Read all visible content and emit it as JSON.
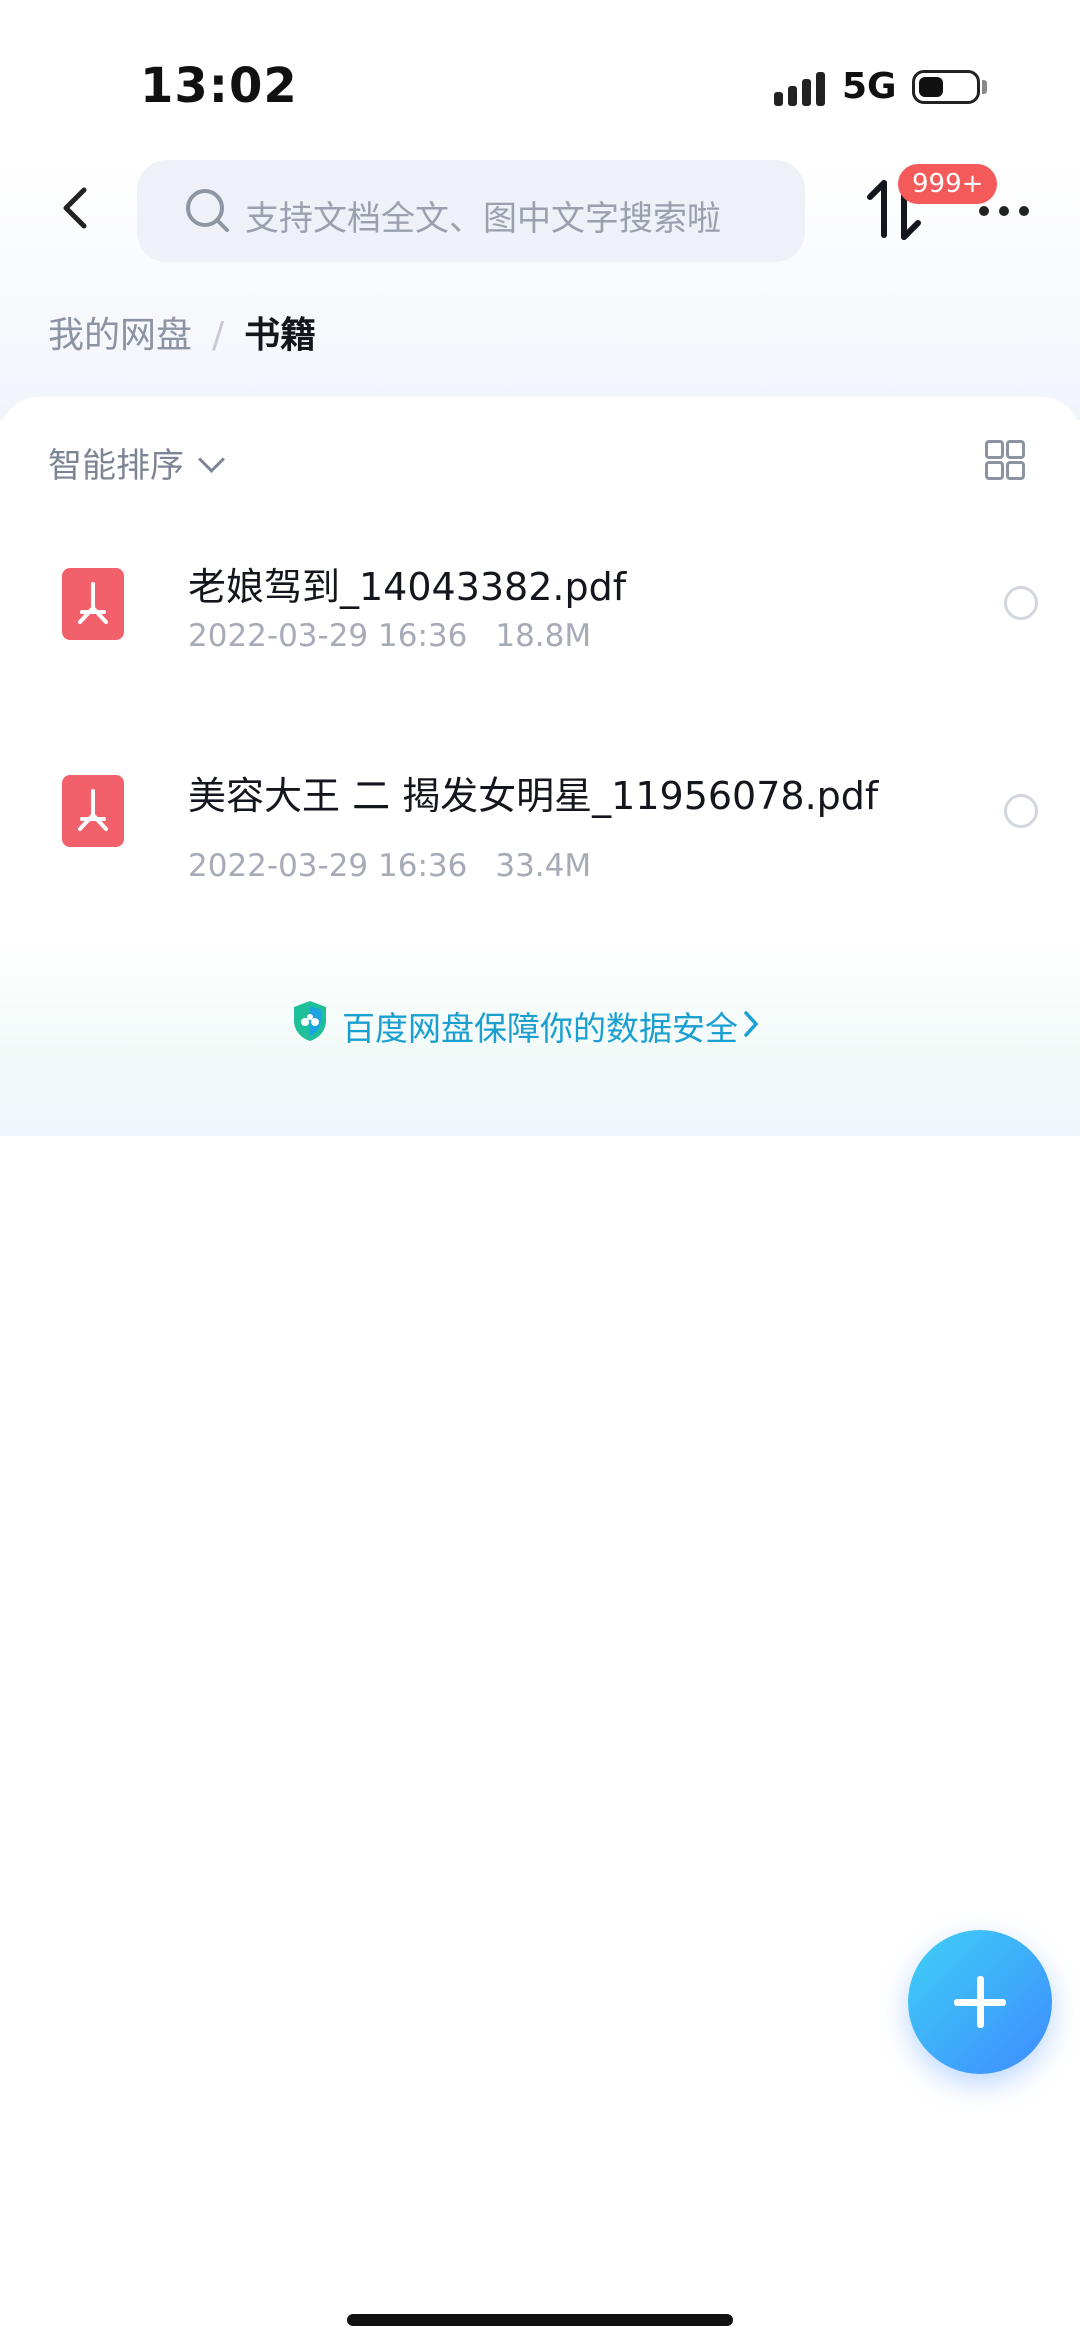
{
  "status_bar": {
    "time": "13:02",
    "network": "5G",
    "icons": [
      "signal-icon",
      "battery-icon"
    ]
  },
  "header": {
    "back_icon": "chevron-left-icon",
    "search": {
      "placeholder": "支持文档全文、图中文字搜索啦",
      "icon": "search-icon"
    },
    "transfer_icon": "transfer-icon",
    "transfer_badge": "999+",
    "more_icon": "more-icon"
  },
  "breadcrumb": {
    "root": "我的网盘",
    "separator": "/",
    "current": "书籍"
  },
  "toolbar": {
    "sort_label": "智能排序",
    "view_toggle_icon": "grid-view-icon"
  },
  "files": [
    {
      "name": "老娘驾到_14043382.pdf",
      "date": "2022-03-29 16:36",
      "size": "18.8M",
      "icon": "pdf-icon"
    },
    {
      "name": "美容大王  二  揭发女明星_11956078.pdf",
      "date": "2022-03-29 16:36",
      "size": "33.4M",
      "icon": "pdf-icon"
    }
  ],
  "security_banner": {
    "text": "百度网盘保障你的数据安全",
    "icon": "shield-icon"
  },
  "fab": {
    "icon": "plus-icon"
  },
  "colors": {
    "accent": "#3e8bff",
    "badge": "#f45a5a",
    "pdf": "#f2616b",
    "security_text": "#1a9fd0"
  }
}
